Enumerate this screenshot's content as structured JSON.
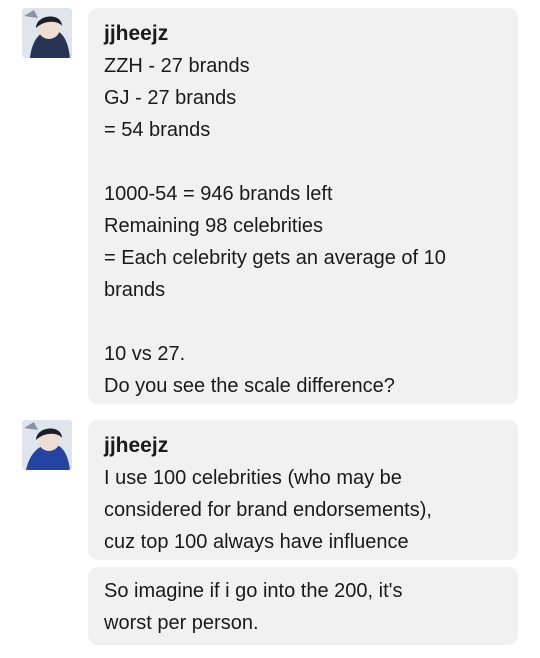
{
  "messages": [
    {
      "username": "jjheejz",
      "lines": [
        "ZZH - 27 brands",
        "GJ - 27 brands",
        "= 54 brands",
        "",
        "1000-54 = 946 brands left",
        "Remaining 98 celebrities",
        "= Each celebrity gets an average of 10",
        "brands",
        "",
        "10 vs 27.",
        "Do you see the scale difference?"
      ]
    },
    {
      "username": "jjheejz",
      "lines": [
        "I use 100 celebrities (who may be",
        "considered for brand endorsements),",
        "cuz top 100 always have influence"
      ]
    },
    {
      "lines": [
        "So imagine if i go into the 200, it's",
        "worst per person."
      ]
    }
  ],
  "colors": {
    "bubble": "#f1f1f1",
    "text": "#1a1a1a",
    "background": "#ffffff"
  },
  "icons": {
    "avatar": "user-avatar-icon"
  }
}
